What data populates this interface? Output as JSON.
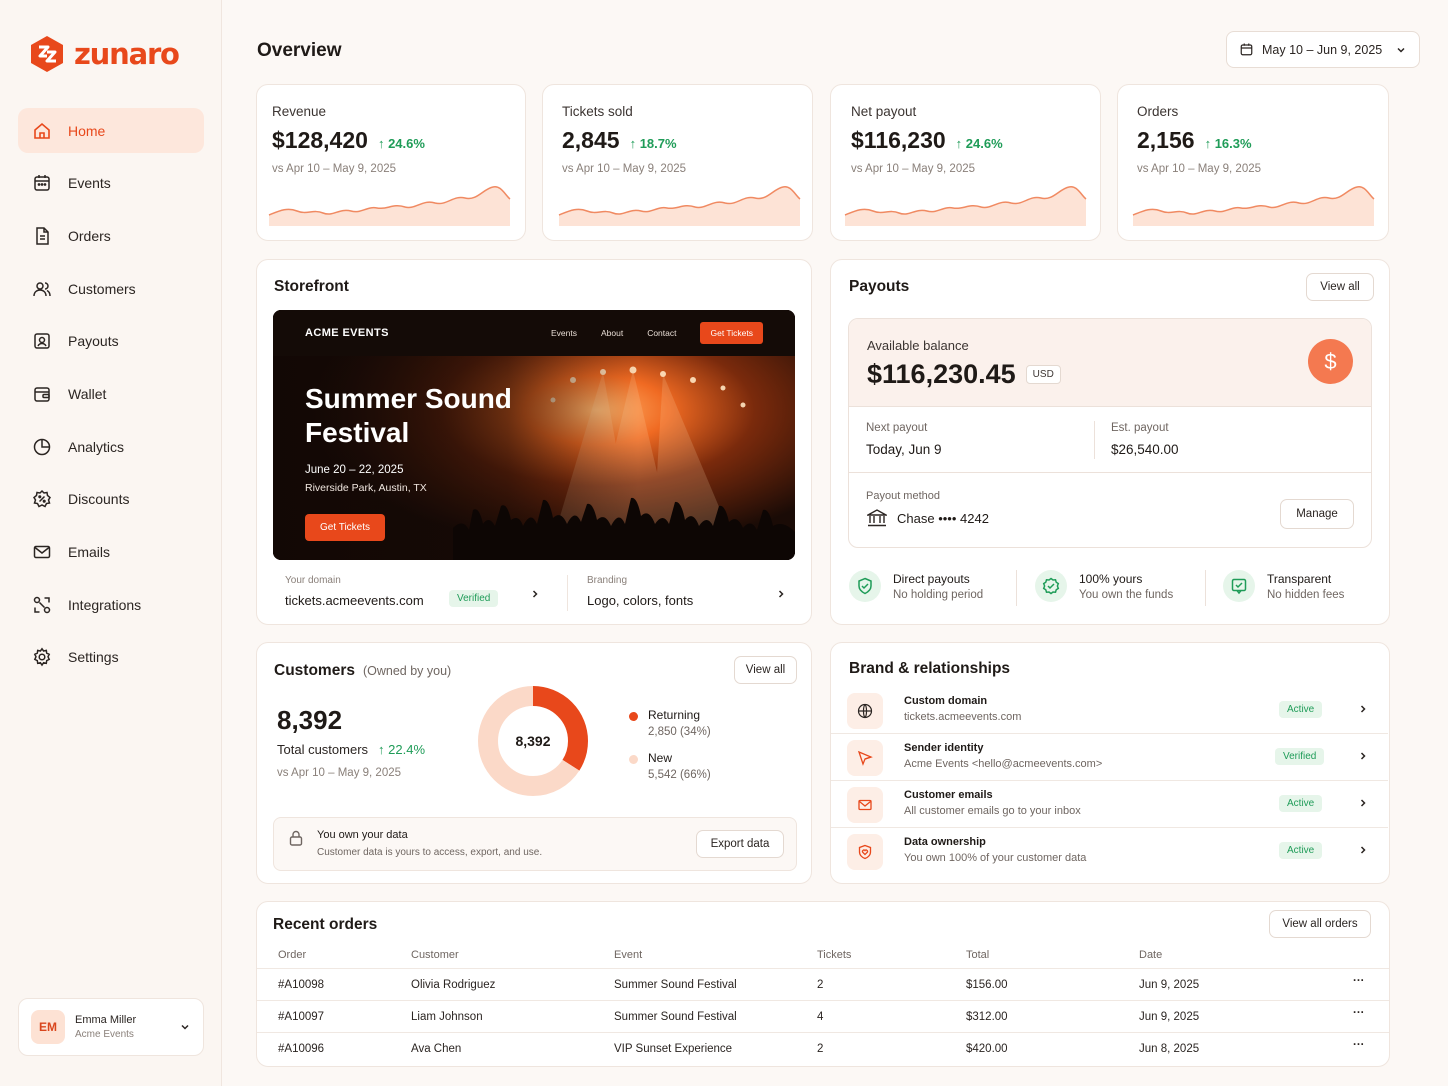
{
  "brand": {
    "name": "zunaro",
    "accent": "#e8481b"
  },
  "sidebar": {
    "items": [
      {
        "label": "Home",
        "icon": "home-icon",
        "active": true
      },
      {
        "label": "Events",
        "icon": "calendar-icon"
      },
      {
        "label": "Orders",
        "icon": "document-icon"
      },
      {
        "label": "Customers",
        "icon": "users-icon"
      },
      {
        "label": "Payouts",
        "icon": "payout-icon"
      },
      {
        "label": "Wallet",
        "icon": "wallet-icon"
      },
      {
        "label": "Analytics",
        "icon": "pie-chart-icon"
      },
      {
        "label": "Discounts",
        "icon": "discount-badge-icon"
      },
      {
        "label": "Emails",
        "icon": "mail-icon"
      },
      {
        "label": "Integrations",
        "icon": "integrations-icon"
      },
      {
        "label": "Settings",
        "icon": "gear-icon"
      }
    ],
    "user": {
      "initials": "EM",
      "name": "Emma Miller",
      "org": "Acme Events"
    }
  },
  "header": {
    "title": "Overview",
    "date_range": "May 10 – Jun 9, 2025"
  },
  "stats": [
    {
      "label": "Revenue",
      "value": "$128,420",
      "delta": "24.6%",
      "compare": "vs Apr 10 – May 9, 2025"
    },
    {
      "label": "Tickets sold",
      "value": "2,845",
      "delta": "18.7%",
      "compare": "vs Apr 10 – May 9, 2025"
    },
    {
      "label": "Net payout",
      "value": "$116,230",
      "delta": "24.6%",
      "compare": "vs Apr 10 – May 9, 2025"
    },
    {
      "label": "Orders",
      "value": "2,156",
      "delta": "16.3%",
      "compare": "vs Apr 10 – May 9, 2025"
    }
  ],
  "storefront": {
    "title": "Storefront",
    "preview": {
      "brand": "ACME EVENTS",
      "links": [
        "Events",
        "About",
        "Contact"
      ],
      "nav_cta": "Get Tickets",
      "event_title": "Summer Sound Festival",
      "event_dates": "June 20 – 22, 2025",
      "event_location": "Riverside Park, Austin, TX",
      "cta": "Get Tickets"
    },
    "domain_label": "Your domain",
    "domain_value": "tickets.acmeevents.com",
    "domain_status": "Verified",
    "branding_label": "Branding",
    "branding_value": "Logo, colors, fonts"
  },
  "payouts": {
    "title": "Payouts",
    "view_all": "View all",
    "balance_label": "Available balance",
    "balance": "$116,230.45",
    "currency": "USD",
    "next_label": "Next payout",
    "next_value": "Today, Jun 9",
    "est_label": "Est. payout",
    "est_value": "$26,540.00",
    "method_label": "Payout method",
    "method_value": "Chase •••• 4242",
    "manage": "Manage",
    "features": [
      {
        "title": "Direct payouts",
        "sub": "No holding period"
      },
      {
        "title": "100% yours",
        "sub": "You own the funds"
      },
      {
        "title": "Transparent",
        "sub": "No hidden fees"
      }
    ]
  },
  "customers": {
    "title": "Customers",
    "subtitle": "(Owned by you)",
    "view_all": "View all",
    "total": "8,392",
    "total_label": "Total customers",
    "delta": "22.4%",
    "compare": "vs Apr 10 – May 9, 2025",
    "donut_center": "8,392",
    "segments": [
      {
        "name": "Returning",
        "detail": "2,850 (34%)",
        "share": 0.34,
        "color": "#e8481b"
      },
      {
        "name": "New",
        "detail": "5,542 (66%)",
        "share": 0.66,
        "color": "#fbd9c8"
      }
    ],
    "data_note_title": "You own your data",
    "data_note_sub": "Customer data is yours to access, export, and use.",
    "export": "Export data"
  },
  "brand_rel": {
    "title": "Brand & relationships",
    "rows": [
      {
        "title": "Custom domain",
        "sub": "tickets.acmeevents.com",
        "status": "Active",
        "icon": "globe-icon"
      },
      {
        "title": "Sender identity",
        "sub": "Acme Events <hello@acmeevents.com>",
        "status": "Verified",
        "icon": "send-icon"
      },
      {
        "title": "Customer emails",
        "sub": "All customer emails go to your inbox",
        "status": "Active",
        "icon": "mail-icon"
      },
      {
        "title": "Data ownership",
        "sub": "You own 100% of your customer data",
        "status": "Active",
        "icon": "shield-heart-icon"
      }
    ]
  },
  "orders": {
    "title": "Recent orders",
    "view_all": "View all orders",
    "columns": [
      "Order",
      "Customer",
      "Event",
      "Tickets",
      "Total",
      "Date"
    ],
    "rows": [
      [
        "#A10098",
        "Olivia Rodriguez",
        "Summer Sound Festival",
        "2",
        "$156.00",
        "Jun 9, 2025"
      ],
      [
        "#A10097",
        "Liam Johnson",
        "Summer Sound Festival",
        "4",
        "$312.00",
        "Jun 9, 2025"
      ],
      [
        "#A10096",
        "Ava Chen",
        "VIP Sunset Experience",
        "2",
        "$420.00",
        "Jun 8, 2025"
      ]
    ]
  }
}
